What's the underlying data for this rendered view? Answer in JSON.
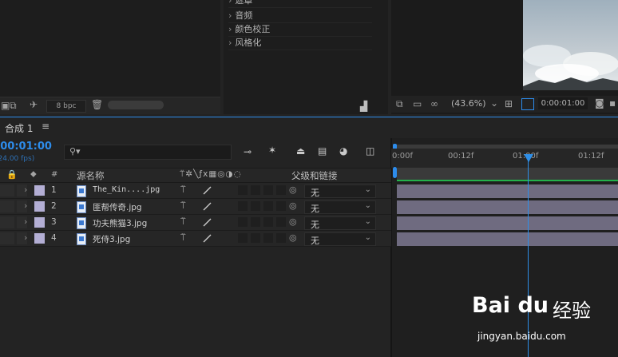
{
  "project_panel": {
    "bpc": "8 bpc"
  },
  "effects_panel": {
    "items": [
      "遮罩",
      "音频",
      "颜色校正",
      "风格化"
    ]
  },
  "viewer": {
    "zoom": "(43.6%)",
    "timecode": "0:00:01:00"
  },
  "timeline": {
    "tab_label": "合成 1",
    "current_time": "0:00:01:00",
    "fps": "(24.00 fps)",
    "search_placeholder": "",
    "columns": {
      "hash": "#",
      "source_name": "源名称",
      "parent": "父级和链接"
    },
    "layers": [
      {
        "num": "1",
        "name": "The_Kin....jpg",
        "parent": "无"
      },
      {
        "num": "2",
        "name": "匪帮传奇.jpg",
        "parent": "无"
      },
      {
        "num": "3",
        "name": "功夫熊猫3.jpg",
        "parent": "无"
      },
      {
        "num": "4",
        "name": "死侍3.jpg",
        "parent": "无"
      }
    ],
    "ruler_ticks": [
      "0:00f",
      "00:12f",
      "01:00f",
      "01:12f"
    ]
  },
  "watermark": {
    "brand": "Bai du",
    "brand_suffix": "经验",
    "url": "jingyan.baidu.com"
  },
  "colors": {
    "accent": "#2d8ceb",
    "layer_label": "#b3aed4",
    "layer_bar": "#6f6b80",
    "work_area_line": "#23b24b"
  }
}
